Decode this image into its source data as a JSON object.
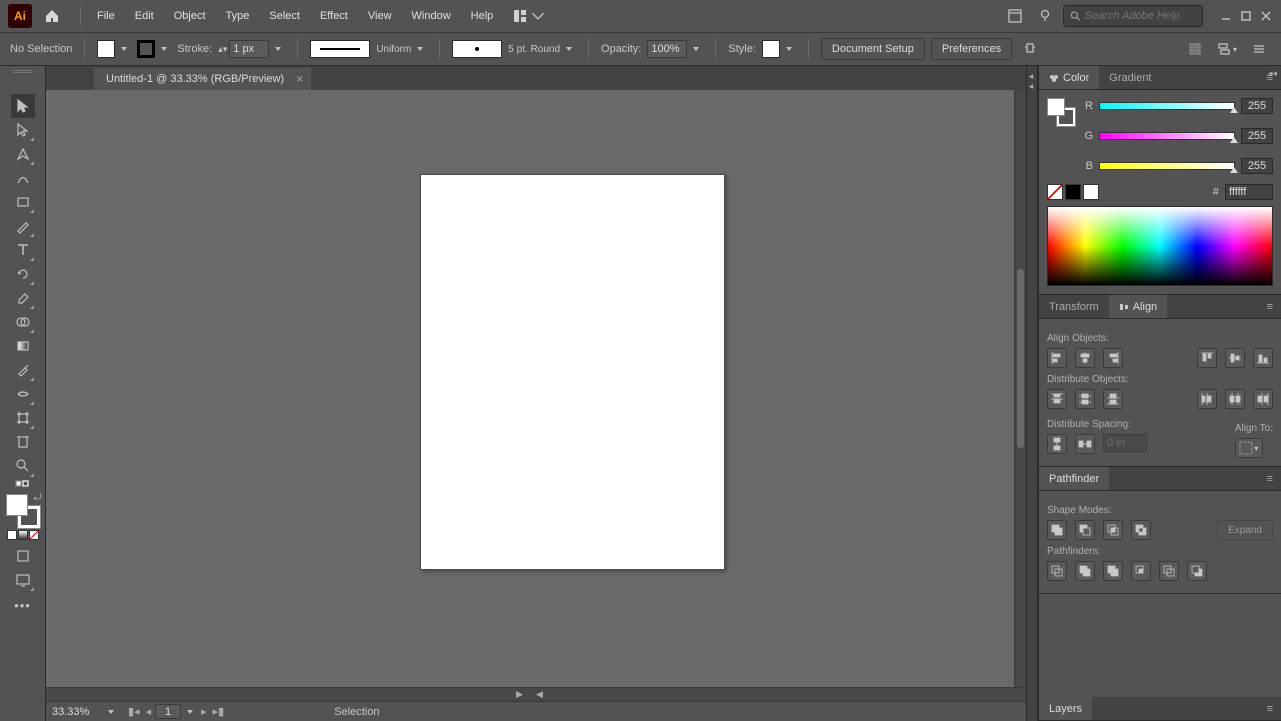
{
  "menu": {
    "file": "File",
    "edit": "Edit",
    "object": "Object",
    "type": "Type",
    "select": "Select",
    "effect": "Effect",
    "view": "View",
    "window": "Window",
    "help": "Help"
  },
  "search": {
    "placeholder": "Search Adobe Help"
  },
  "ctrl": {
    "noSelection": "No Selection",
    "strokeLabel": "Stroke:",
    "strokeVal": "1 px",
    "uniform": "Uniform",
    "brush": "5 pt. Round",
    "opacityLabel": "Opacity:",
    "opacityVal": "100%",
    "styleLabel": "Style:",
    "docSetup": "Document Setup",
    "prefs": "Preferences"
  },
  "tab": {
    "title": "Untitled-1 @ 33.33% (RGB/Preview)"
  },
  "status": {
    "zoom": "33.33%",
    "page": "1",
    "tool": "Selection"
  },
  "panels": {
    "color": "Color",
    "gradient": "Gradient",
    "r": "R",
    "g": "G",
    "b": "B",
    "rval": "255",
    "gval": "255",
    "bval": "255",
    "hex": "ffffff",
    "transform": "Transform",
    "align": "Align",
    "alignObjects": "Align Objects:",
    "distObjects": "Distribute Objects:",
    "distSpacing": "Distribute Spacing:",
    "alignTo": "Align To:",
    "spaceVal": "0 in",
    "pathfinder": "Pathfinder",
    "shapeModes": "Shape Modes:",
    "pathfinders": "Pathfinders:",
    "expand": "Expand",
    "layers": "Layers"
  }
}
